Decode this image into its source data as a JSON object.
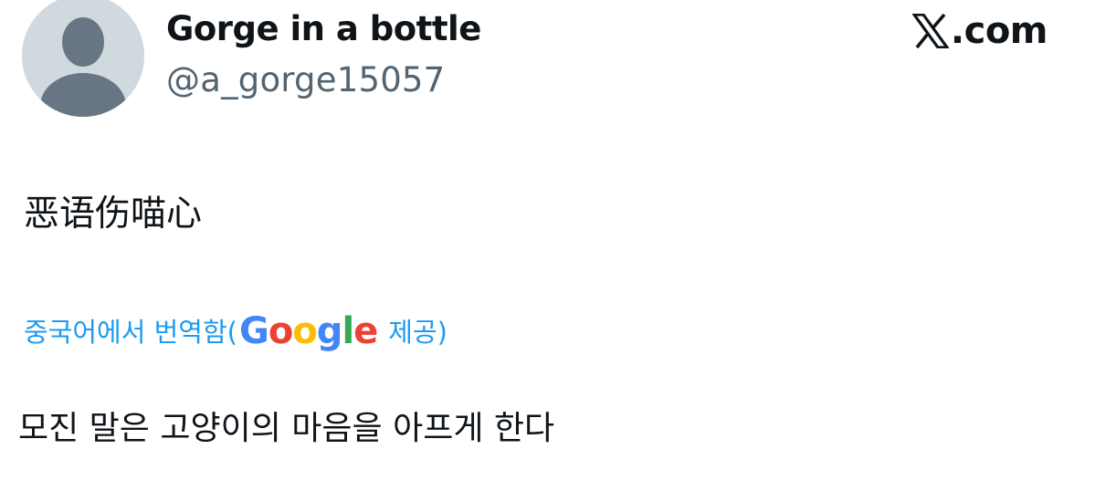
{
  "author": {
    "display_name": "Gorge in a bottle",
    "handle": "@a_gorge15057",
    "avatar_icon": "default-avatar-icon"
  },
  "brand": {
    "logo_icon": "x-logo-icon",
    "text": ".com"
  },
  "tweet": {
    "text": "恶语伤喵心"
  },
  "translation": {
    "prefix": "중국어에서 번역함(",
    "provider_letters": [
      "G",
      "o",
      "o",
      "g",
      "l",
      "e"
    ],
    "provider_colors": [
      "#4285F4",
      "#EA4335",
      "#FBBC05",
      "#4285F4",
      "#34A853",
      "#EA4335"
    ],
    "suffix": " 제공)",
    "text": "모진 말은 고양이의 마음을 아프게 한다"
  },
  "colors": {
    "link": "#1d9bf0",
    "primary_text": "#0f1419",
    "secondary_text": "#536471",
    "avatar_bg": "#cfd9de",
    "avatar_fg": "#687684"
  }
}
